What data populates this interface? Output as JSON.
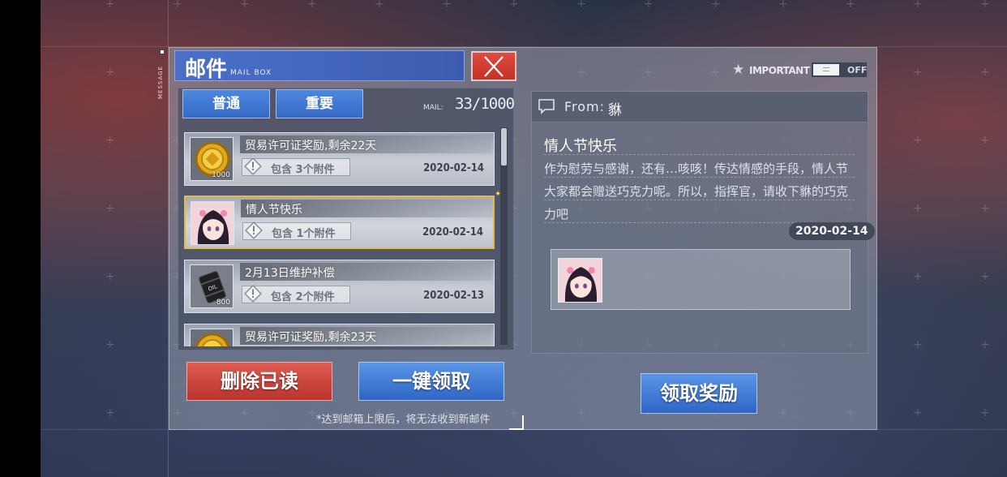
{
  "header": {
    "title": "邮件",
    "subtitle": "MAIL BOX",
    "side_label": "MESSAGE"
  },
  "tabs": [
    {
      "label": "普通"
    },
    {
      "label": "重要"
    }
  ],
  "mail_count": {
    "label": "MAIL:",
    "value": "33/1000"
  },
  "mails": [
    {
      "subject": "贸易许可证奖励,剩余22天",
      "attachment": "包含 3个附件",
      "date": "2020-02-14",
      "icon": "gold-coin-icon",
      "count": "1000",
      "selected": false
    },
    {
      "subject": "情人节快乐",
      "attachment": "包含 1个附件",
      "date": "2020-02-14",
      "icon": "character-portrait",
      "count": "",
      "selected": true
    },
    {
      "subject": "2月13日维护补偿",
      "attachment": "包含 2个附件",
      "date": "2020-02-13",
      "icon": "oil-barrel-icon",
      "count": "800",
      "selected": false
    },
    {
      "subject": "贸易许可证奖励,剩余23天",
      "attachment": "",
      "date": "",
      "icon": "gold-coin-icon",
      "count": "",
      "selected": false
    }
  ],
  "buttons": {
    "delete_read": "删除已读",
    "claim_all": "一键领取",
    "claim_reward": "领取奖励"
  },
  "footnote": "*达到邮箱上限后，将无法收到新邮件",
  "important_toggle": {
    "label": "IMPORTANT",
    "state": "OFF"
  },
  "detail": {
    "from_label": "From:",
    "from_name": "貅",
    "title": "情人节快乐",
    "body": "作为慰劳与感谢，还有…咳咳！传达情感的手段，情人节大家都会赠送巧克力呢。所以，指挥官，请收下貅的巧克力吧",
    "date": "2020-02-14"
  },
  "colors": {
    "accent_blue": "#3d5cb0",
    "close_red": "#d23e32",
    "selected_border": "#e8b93a",
    "delete_red": "#c8443a"
  }
}
